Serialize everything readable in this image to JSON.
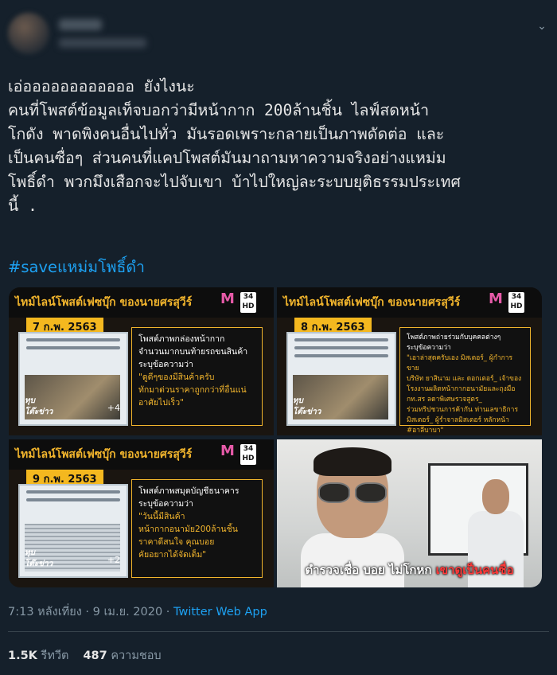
{
  "tweet": {
    "text": "เอ่ออออออออออออ ยังไงนะ\nคนที่โพสต์ข้อมูลเท็จบอกว่ามีหน้ากาก 200ล้านชิ้น ไลฟ์สดหน้า\nโกดัง พาดพิงคนอื่นไปทั่ว มันรอดเพราะกลายเป็นภาพดัดต่อ และ\nเป็นคนซื่อๆ ส่วนคนที่แคปโพสต์มันมาถามหาความจริงอย่างแหม่ม\nโพธิ์ดำ พวกมึงเสือกจะไปจับเขา บ้าไปใหญ่ละระบบยุติธรรมประเทศ\nนี้ .",
    "hashtag": "#saveแหม่มโพธิ์ดำ"
  },
  "media": {
    "panels": [
      {
        "title": "ไทม์ไลน์โพสต์เฟซบุ๊ก  ของนายศรสุวีร์",
        "date": "7 ก.พ. 2563",
        "caption": "โพสต์ภาพกล่องหน้ากาก\nจำนวนมากบนท้ายรถขนสินค้า\nระบุข้อความว่า",
        "quote": "\"ดูดีๆของมีสินค้าครับ\nทักมาด่วนราคาถูกกว่าที่อื่นแน่\nอาศัยไปเร็ว\"",
        "plus": "+4",
        "stamp": "ทุบ",
        "stamp_sub": "โต๊ะข่าว"
      },
      {
        "title": "ไทม์ไลน์โพสต์เฟซบุ๊ก  ของนายศรสุวีร์",
        "date": "8 ก.พ. 2563",
        "caption": "โพสต์ภาพถ่ายร่วมกับบุคคลต่างๆ\nระบุข้อความว่า",
        "quote": "\"เอาล่าสุดครับเอง มิสเตอร์_ ผู้กำการขาย\nบริษัท ยาสินาม และ ดอกเตอร์_ เจ้าของ\nโรงงานผลิตหน้ากากอนามัยและถุงมือ\nกท.สร ลดาพิเศษรวจสูตร_\nร่วมทริปชวนการค้ากัน ท่านเลขาธิการ\nมิสเตอร์_ ผู้ร่ำจาลมิสเตอร์ หลักหน้า\n#อาลีบาบา\"",
        "plus": "",
        "stamp": "ทุบ",
        "stamp_sub": "โต๊ะข่าว"
      },
      {
        "title": "ไทม์ไลน์โพสต์เฟซบุ๊ก  ของนายศรสุวีร์",
        "date": "9 ก.พ. 2563",
        "caption": "โพสต์ภาพสมุดบัญชีธนาคาร\nระบุข้อความว่า",
        "quote": "\"วันนี้มีสินค้า\nหน้ากากอนามัย200ล้านชิ้น\nราคาดีสนใจ คุณบอย\nคัยอยากได้จัดเต็ม\"",
        "plus": "+2",
        "stamp": "ทุบ",
        "stamp_sub": "โต๊ะข่าว"
      }
    ],
    "video_subtitle": {
      "white": "ตำรวจเชื่อ บอย ไม่โกหก ",
      "red": "เขาดูเป็นคนซื่อ"
    },
    "logo": {
      "mark": "M",
      "text": "AMARIN",
      "channel": "34 HD"
    }
  },
  "meta": {
    "time": "7:13 หลังเที่ยง · 9 เม.ย. 2020 · ",
    "app": "Twitter Web App"
  },
  "stats": {
    "retweets_count": "1.5K",
    "retweets_label": " รีทวีต",
    "likes_count": "487",
    "likes_label": " ความชอบ"
  },
  "icons": {
    "chevron": "chevron-down-icon"
  }
}
